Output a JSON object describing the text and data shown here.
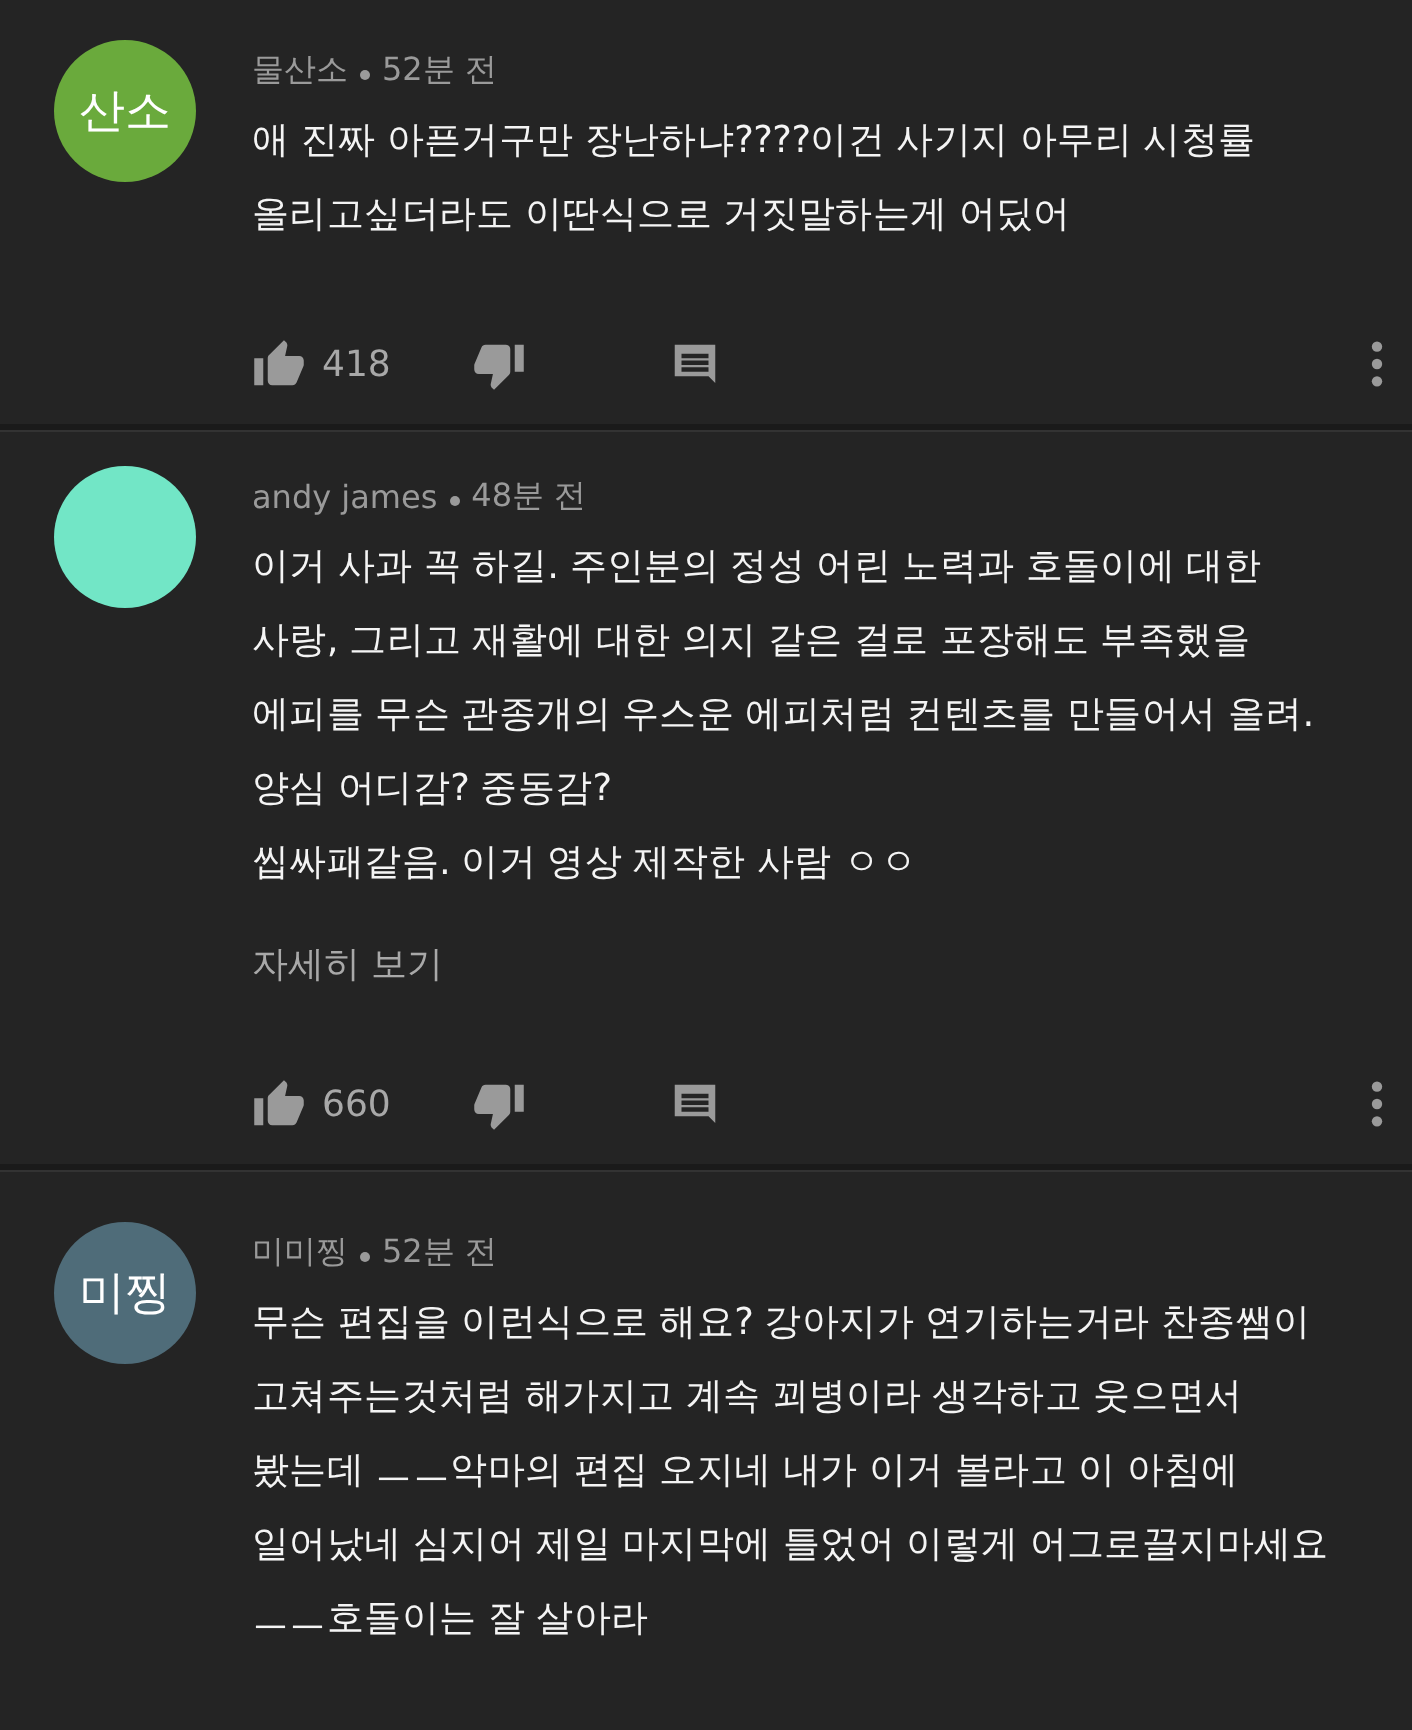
{
  "comments": [
    {
      "author": "물산소",
      "time": "52분 전",
      "avatar": {
        "text": "산소",
        "color": "#6aaa3c"
      },
      "lines": [
        "애 진짜 아픈거구만 장난하냐????이건 사기지 아무리 시청률",
        "올리고싶더라도 이딴식으로 거짓말하는게 어딨어"
      ],
      "likes": "418"
    },
    {
      "author": "andy james",
      "time": "48분 전",
      "avatar": {
        "color": "#72e6c6"
      },
      "lines": [
        "이거 사과 꼭 하길. 주인분의 정성 어린 노력과 호돌이에 대한",
        "사랑, 그리고 재활에 대한 의지 같은 걸로 포장해도 부족했을",
        "에피를 무슨 관종개의 우스운 에피처럼 컨텐츠를 만들어서 올려.",
        "양심 어디감? 중동감?",
        "씹싸패같음. 이거 영상 제작한 사람 ㅇㅇ"
      ],
      "more": "자세히 보기",
      "likes": "660"
    },
    {
      "author": "미미찡",
      "time": "52분 전",
      "avatar": {
        "text": "미찡",
        "color": "#4f6c79"
      },
      "lines": [
        "무슨 편집을 이런식으로 해요? 강아지가 연기하는거라 찬종쌤이",
        "고쳐주는것처럼 해가지고 계속 꾀병이라 생각하고 웃으면서",
        "봤는데 ㅡㅡ악마의 편집 오지네 내가 이거 볼라고 이 아침에",
        "일어났네 심지어 제일 마지막에 틀었어 이렇게 어그로끌지마세요",
        "ㅡㅡ호돌이는 잘 살아라"
      ]
    }
  ]
}
